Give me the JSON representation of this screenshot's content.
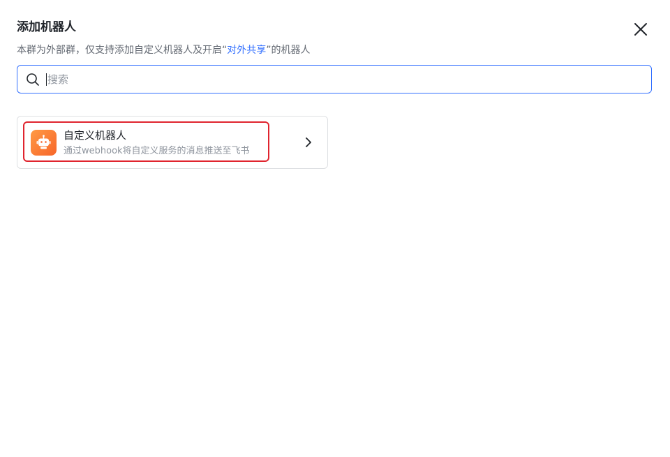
{
  "dialog": {
    "title": "添加机器人",
    "subtitle_prefix": "本群为外部群，仅支持添加自定义机器人及开启“",
    "subtitle_link": "对外共享",
    "subtitle_suffix": "”的机器人",
    "close_icon": "close-icon"
  },
  "search": {
    "placeholder": "搜索",
    "value": "",
    "icon": "search-icon"
  },
  "bots": [
    {
      "name": "自定义机器人",
      "description": "通过webhook将自定义服务的消息推送至飞书",
      "icon": "robot-icon"
    }
  ],
  "colors": {
    "accent": "#3370ff",
    "highlight": "#e0242e",
    "avatar_start": "#ff9a44",
    "avatar_end": "#f7662a"
  }
}
